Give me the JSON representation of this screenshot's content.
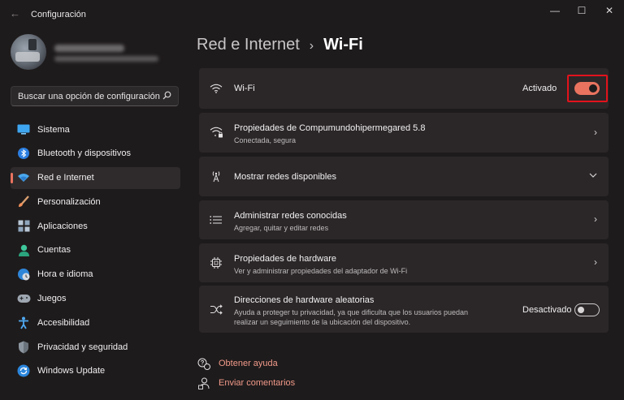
{
  "window": {
    "title": "Configuración",
    "controls": {
      "minimize": "—",
      "maximize": "☐",
      "close": "✕"
    }
  },
  "search": {
    "placeholder": "Buscar una opción de configuración",
    "icon": "search-icon"
  },
  "sidebar": {
    "items": [
      {
        "label": "Sistema",
        "icon": "system-icon",
        "active": false
      },
      {
        "label": "Bluetooth y dispositivos",
        "icon": "bluetooth-icon",
        "active": false
      },
      {
        "label": "Red e Internet",
        "icon": "network-icon",
        "active": true
      },
      {
        "label": "Personalización",
        "icon": "brush-icon",
        "active": false
      },
      {
        "label": "Aplicaciones",
        "icon": "apps-icon",
        "active": false
      },
      {
        "label": "Cuentas",
        "icon": "account-icon",
        "active": false
      },
      {
        "label": "Hora e idioma",
        "icon": "globe-clock-icon",
        "active": false
      },
      {
        "label": "Juegos",
        "icon": "gamepad-icon",
        "active": false
      },
      {
        "label": "Accesibilidad",
        "icon": "accessibility-icon",
        "active": false
      },
      {
        "label": "Privacidad y seguridad",
        "icon": "shield-icon",
        "active": false
      },
      {
        "label": "Windows Update",
        "icon": "update-icon",
        "active": false
      }
    ]
  },
  "breadcrumb": {
    "parent": "Red e Internet",
    "separator": "›",
    "current": "Wi-Fi"
  },
  "cards": {
    "wifi": {
      "title": "Wi-Fi",
      "status": "Activado",
      "toggle_on": true
    },
    "properties": {
      "title": "Propiedades de Compumundohipermegared 5.8",
      "subtitle": "Conectada, segura"
    },
    "available": {
      "title": "Mostrar redes disponibles"
    },
    "known": {
      "title": "Administrar redes conocidas",
      "subtitle": "Agregar, quitar y editar redes"
    },
    "hardware": {
      "title": "Propiedades de hardware",
      "subtitle": "Ver y administrar propiedades del adaptador de Wi-Fi"
    },
    "random": {
      "title": "Direcciones de hardware aleatorias",
      "subtitle_line1": "Ayuda a proteger tu privacidad, ya que dificulta que los usuarios puedan",
      "subtitle_line2": "realizar un seguimiento de la ubicación del dispositivo.",
      "status": "Desactivado",
      "toggle_on": false
    }
  },
  "help": {
    "get_help": "Obtener ayuda",
    "feedback": "Enviar comentarios"
  },
  "colors": {
    "accent": "#e9735f",
    "highlight": "#e3121c",
    "background": "#1e1b1c",
    "card": "#2b2728"
  }
}
